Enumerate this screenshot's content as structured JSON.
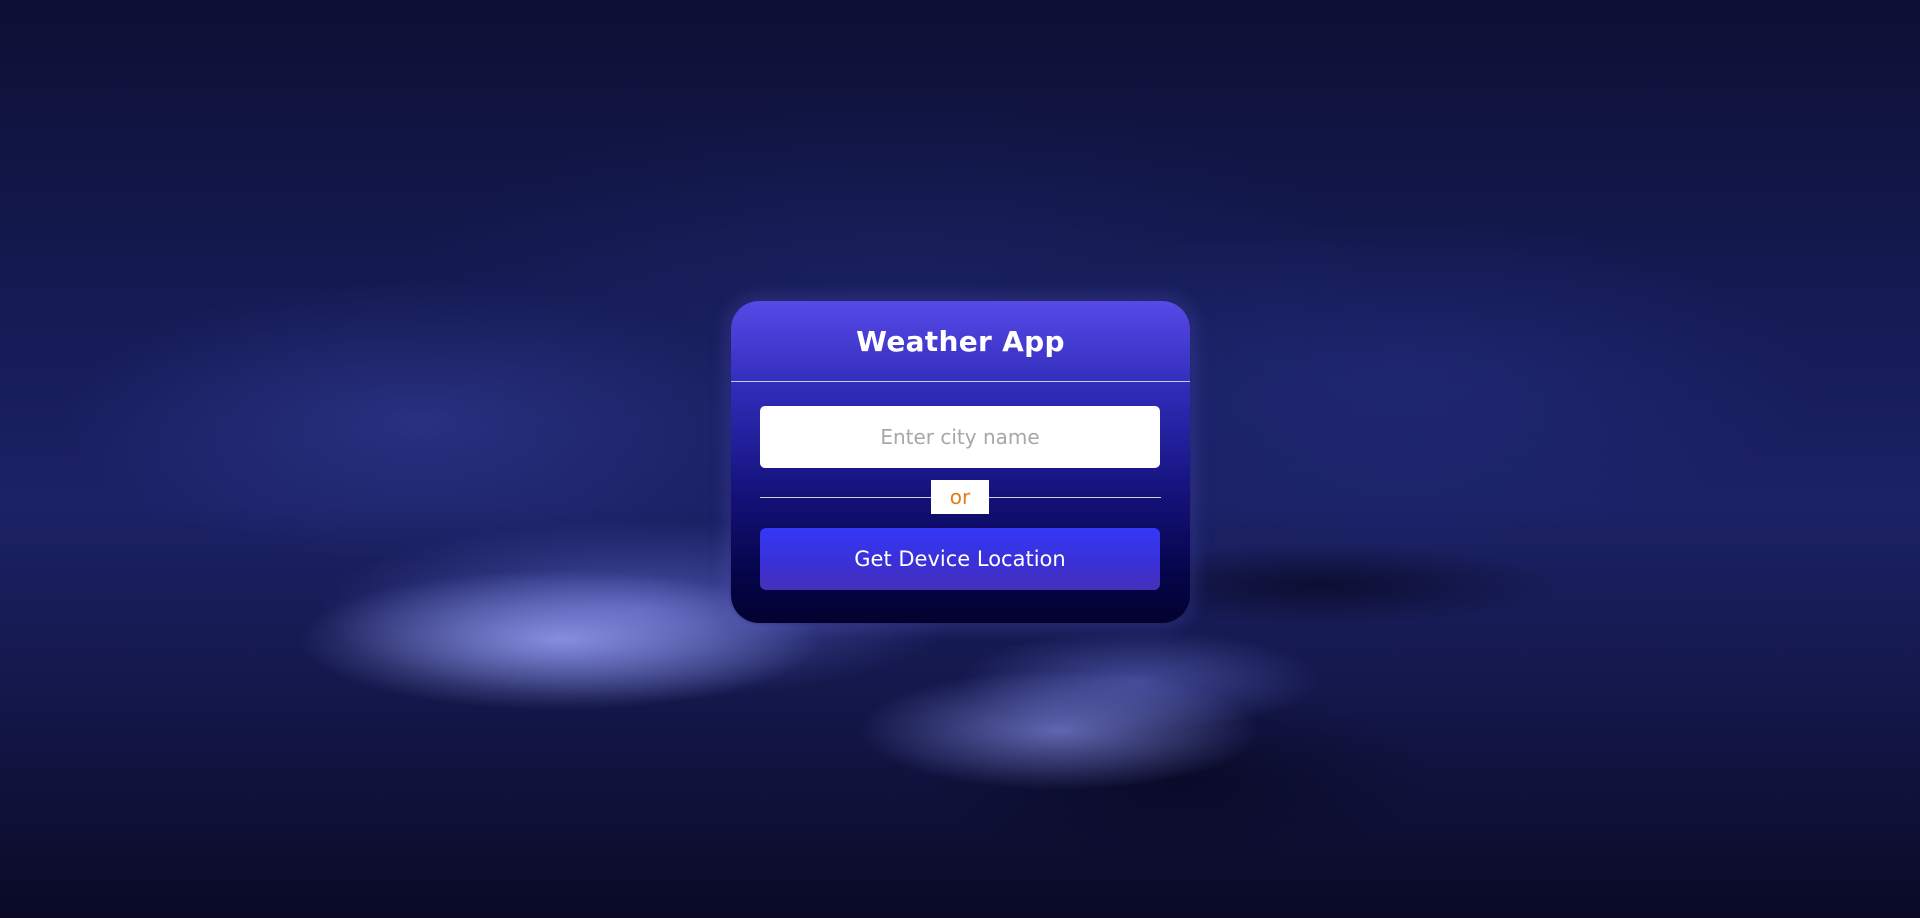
{
  "app": {
    "title": "Weather App"
  },
  "search": {
    "placeholder": "Enter city name",
    "value": ""
  },
  "separator": {
    "label": "or"
  },
  "actions": {
    "location_button_label": "Get Device Location"
  },
  "colors": {
    "card_top": "#574ae8",
    "card_bottom": "#03022e",
    "button": "#3338f6",
    "separator_text": "#e57a17"
  }
}
